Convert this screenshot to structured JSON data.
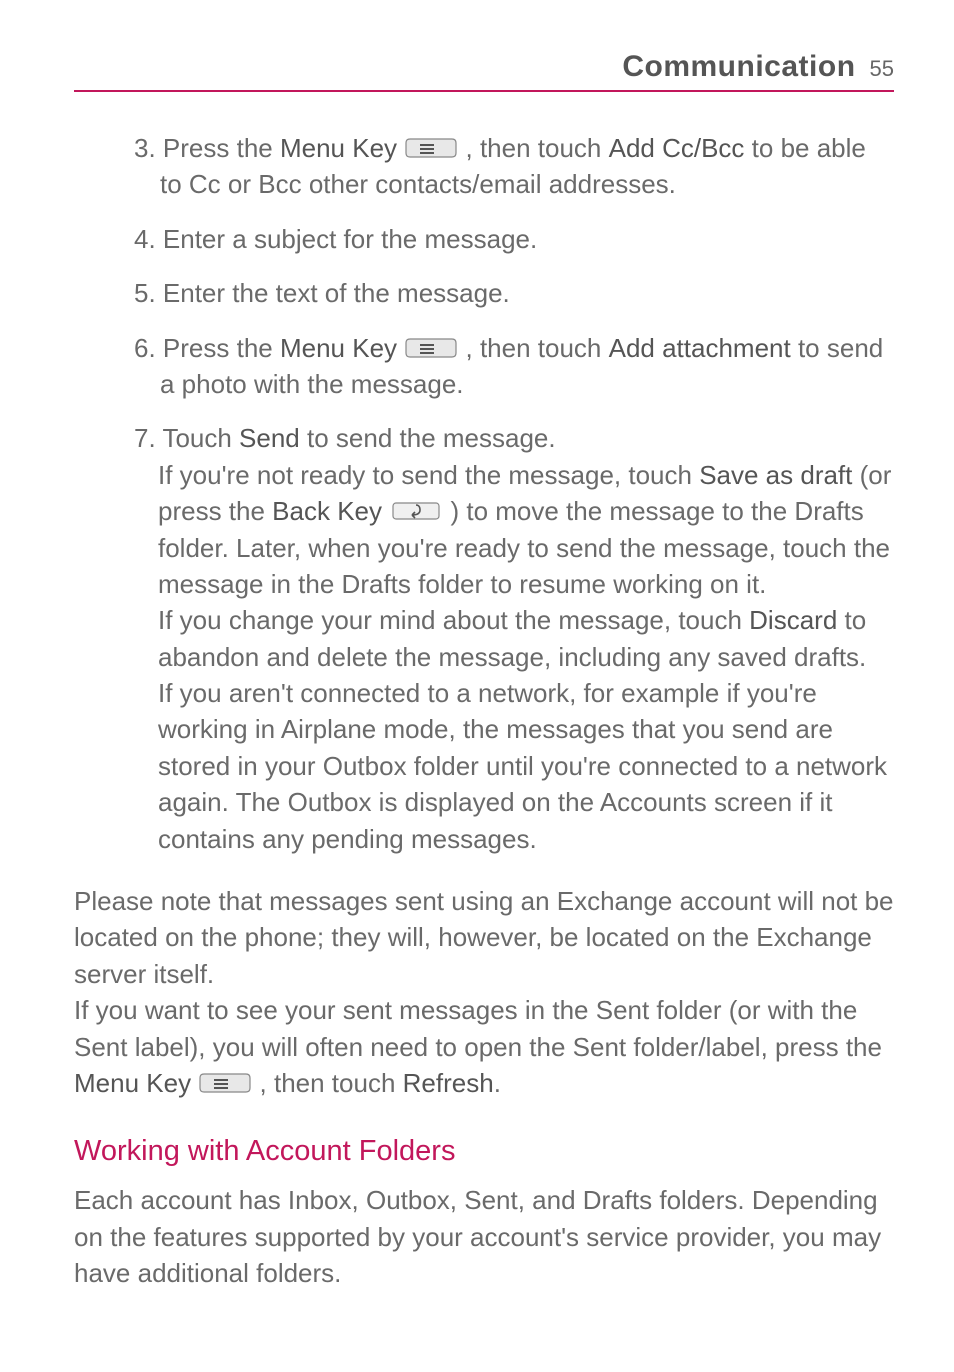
{
  "header": {
    "title": "Communication",
    "page_number": "55"
  },
  "steps": {
    "s3_a": "3. Press the ",
    "menu_key": "Menu Key",
    "s3_b": " , then touch ",
    "add_ccbcc": "Add Cc/Bcc",
    "s3_c": " to be able to Cc or Bcc other contacts/email addresses.",
    "s4": "4. Enter a subject for the message.",
    "s5": "5. Enter the text of the message.",
    "s6_a": "6. Press the ",
    "s6_b": " , then touch ",
    "add_attachment": "Add attachment",
    "s6_c": " to send a photo with the message.",
    "s7_a": "7. Touch ",
    "send": "Send",
    "s7_b": " to send the message.",
    "s7_p1_a": "If you're not ready to send the message, touch ",
    "save_as_draft": "Save as draft",
    "s7_p1_b": " (or press the ",
    "back_key": "Back Key",
    "s7_p1_c": " ) to move the message to the Drafts folder. Later, when you're ready to send the message, touch the message in the Drafts folder to resume working on it.",
    "s7_p2_a": "If you change your mind about the message, touch ",
    "discard": "Discard",
    "s7_p2_b": " to abandon and delete the message, including any saved drafts.",
    "s7_p3": "If you aren't connected to a network, for example if you're working in Airplane mode, the messages that you send are stored in your Outbox folder until you're connected to a network again. The Outbox is displayed on the Accounts screen if it contains any pending messages."
  },
  "body": {
    "p1": "Please note that messages sent using an Exchange account will not be located on the phone; they will, however, be located on the Exchange server itself.",
    "p2_a": "If you want to see your sent messages in the Sent folder (or with the Sent label), you will often need to open the Sent folder/label, press the ",
    "p2_b": " , then touch ",
    "refresh": "Refresh",
    "p2_c": "."
  },
  "section": {
    "heading": "Working with Account Folders",
    "body": "Each account has Inbox, Outbox, Sent, and Drafts folders. Depending on the features supported by your account's service provider, you may have additional folders."
  }
}
